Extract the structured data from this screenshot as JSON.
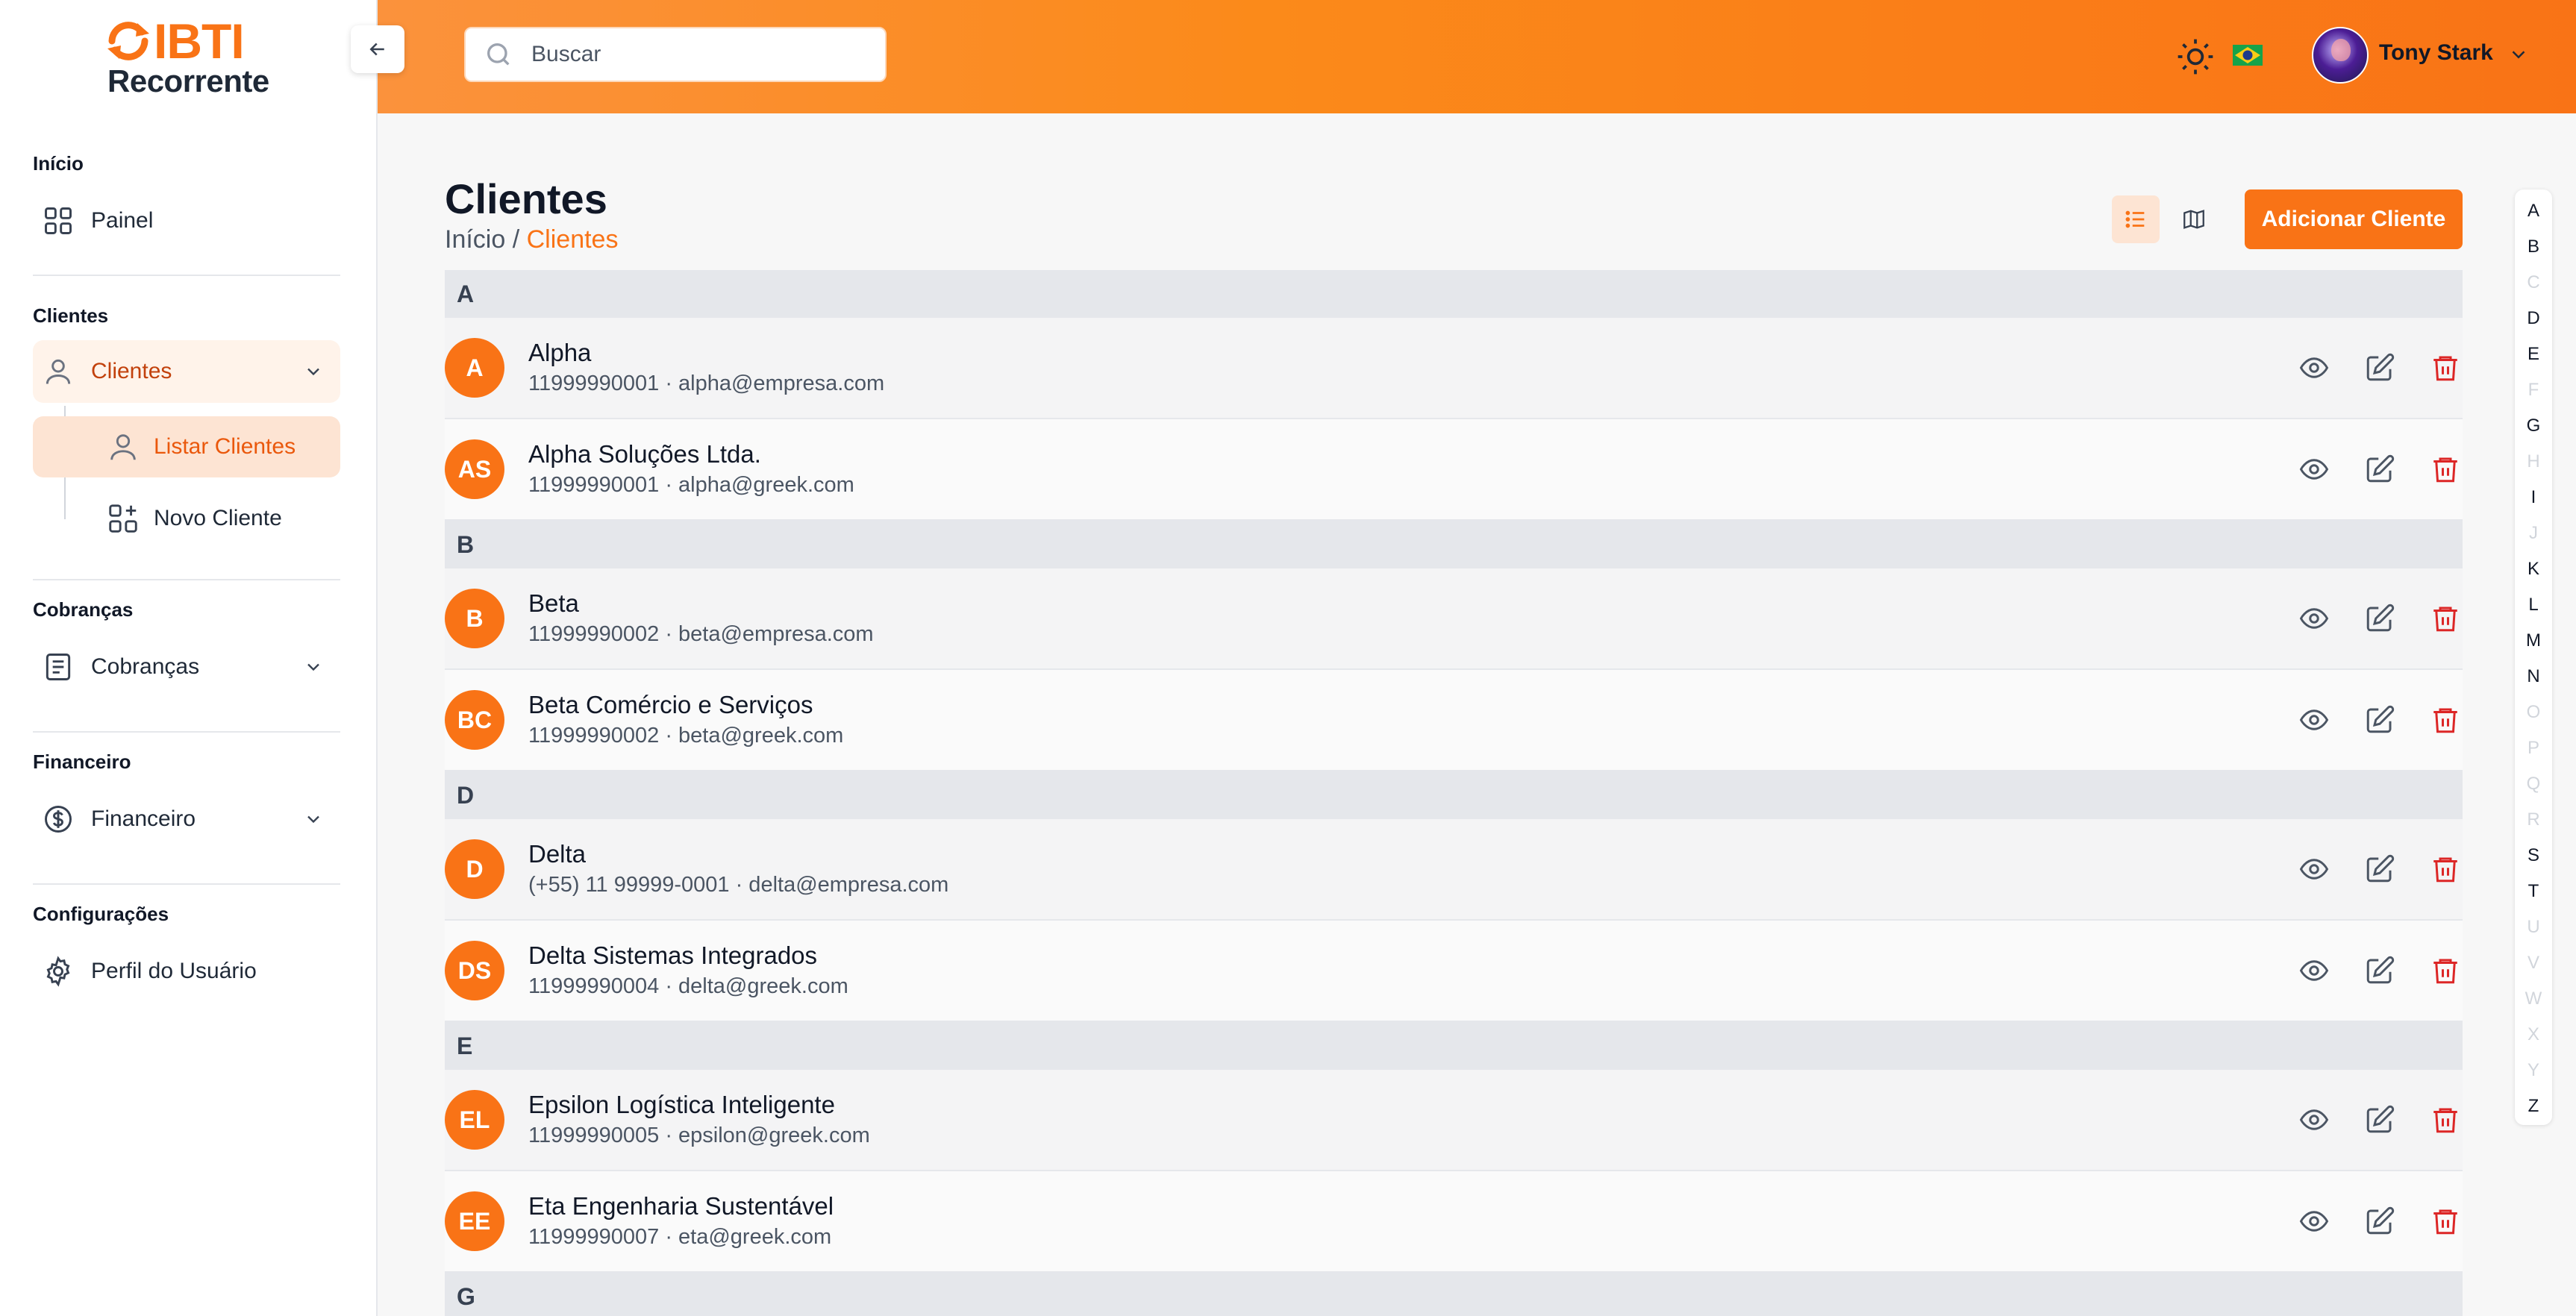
{
  "brand": {
    "name": "IBTI",
    "sub": "Recorrente"
  },
  "sidebar": {
    "sections": [
      {
        "title": "Início"
      },
      {
        "title": "Clientes"
      },
      {
        "title": "Cobranças"
      },
      {
        "title": "Financeiro"
      },
      {
        "title": "Configurações"
      }
    ],
    "items": {
      "painel": "Painel",
      "clientes": "Clientes",
      "listar_clientes": "Listar Clientes",
      "novo_cliente": "Novo Cliente",
      "cobrancas": "Cobranças",
      "financeiro": "Financeiro",
      "perfil": "Perfil do Usuário"
    }
  },
  "header": {
    "search_placeholder": "Buscar",
    "user_name": "Tony Stark"
  },
  "page": {
    "title": "Clientes",
    "breadcrumb_home": "Início",
    "breadcrumb_sep": "/",
    "breadcrumb_current": "Clientes",
    "add_button": "Adicionar Cliente"
  },
  "groups": [
    {
      "letter": "A",
      "clients": [
        {
          "initials": "A",
          "name": "Alpha",
          "meta": "11999990001 · alpha@empresa.com"
        },
        {
          "initials": "AS",
          "name": "Alpha Soluções Ltda.",
          "meta": "11999990001 · alpha@greek.com"
        }
      ]
    },
    {
      "letter": "B",
      "clients": [
        {
          "initials": "B",
          "name": "Beta",
          "meta": "11999990002 · beta@empresa.com"
        },
        {
          "initials": "BC",
          "name": "Beta Comércio e Serviços",
          "meta": "11999990002 · beta@greek.com"
        }
      ]
    },
    {
      "letter": "D",
      "clients": [
        {
          "initials": "D",
          "name": "Delta",
          "meta": "(+55) 11 99999-0001 · delta@empresa.com"
        },
        {
          "initials": "DS",
          "name": "Delta Sistemas Integrados",
          "meta": "11999990004 · delta@greek.com"
        }
      ]
    },
    {
      "letter": "E",
      "clients": [
        {
          "initials": "EL",
          "name": "Epsilon Logística Inteligente",
          "meta": "11999990005 · epsilon@greek.com"
        },
        {
          "initials": "EE",
          "name": "Eta Engenharia Sustentável",
          "meta": "11999990007 · eta@greek.com"
        }
      ]
    },
    {
      "letter": "G",
      "clients": []
    }
  ],
  "alphabet": [
    {
      "l": "A",
      "on": true
    },
    {
      "l": "B",
      "on": true
    },
    {
      "l": "C",
      "on": false
    },
    {
      "l": "D",
      "on": true
    },
    {
      "l": "E",
      "on": true
    },
    {
      "l": "F",
      "on": false
    },
    {
      "l": "G",
      "on": true
    },
    {
      "l": "H",
      "on": false
    },
    {
      "l": "I",
      "on": true
    },
    {
      "l": "J",
      "on": false
    },
    {
      "l": "K",
      "on": true
    },
    {
      "l": "L",
      "on": true
    },
    {
      "l": "M",
      "on": true
    },
    {
      "l": "N",
      "on": true
    },
    {
      "l": "O",
      "on": false
    },
    {
      "l": "P",
      "on": false
    },
    {
      "l": "Q",
      "on": false
    },
    {
      "l": "R",
      "on": false
    },
    {
      "l": "S",
      "on": true
    },
    {
      "l": "T",
      "on": true
    },
    {
      "l": "U",
      "on": false
    },
    {
      "l": "V",
      "on": false
    },
    {
      "l": "W",
      "on": false
    },
    {
      "l": "X",
      "on": false
    },
    {
      "l": "Y",
      "on": false
    },
    {
      "l": "Z",
      "on": true
    }
  ],
  "icons": {
    "collapse": "arrow-left-icon",
    "search": "search-icon",
    "theme": "sun-icon",
    "language": "brazil-flag-icon",
    "view": "eye-icon",
    "edit": "edit-icon",
    "delete": "trash-icon",
    "list_view": "list-icon",
    "map_view": "map-icon"
  },
  "colors": {
    "accent": "#f97316",
    "danger": "#dc2626"
  }
}
